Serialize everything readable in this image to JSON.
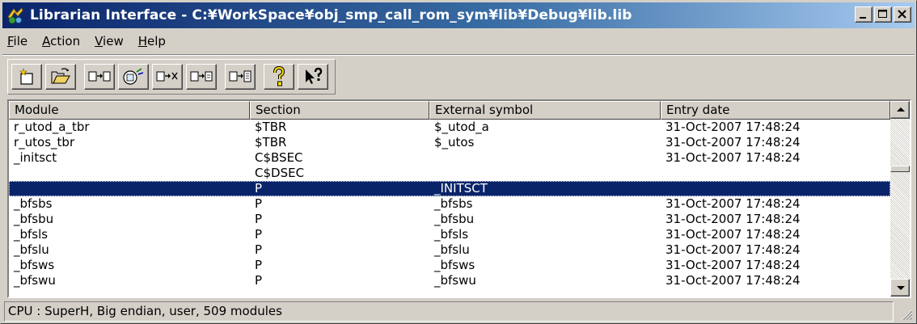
{
  "window": {
    "title": "Librarian Interface - C:¥WorkSpace¥obj_smp_call_rom_sym¥lib¥Debug¥lib.lib",
    "app_icon": "librarian-app-icon"
  },
  "menu": {
    "items": [
      {
        "label_acc": "F",
        "label_rest": "ile"
      },
      {
        "label_acc": "A",
        "label_rest": "ction"
      },
      {
        "label_acc": "V",
        "label_rest": "iew"
      },
      {
        "label_acc": "H",
        "label_rest": "elp"
      }
    ]
  },
  "toolbar": {
    "buttons": [
      "new-library-icon",
      "open-icon",
      "add-module-icon",
      "extract-module-icon",
      "delete-module-icon",
      "replace-module-icon",
      "list-icon",
      "help-icon",
      "context-help-icon"
    ]
  },
  "list": {
    "columns": [
      "Module",
      "Section",
      "External symbol",
      "Entry date"
    ],
    "rows": [
      [
        "r_utod_a_tbr",
        "$TBR",
        "$_utod_a",
        "31-Oct-2007 17:48:24"
      ],
      [
        "r_utos_tbr",
        "$TBR",
        "$_utos",
        "31-Oct-2007 17:48:24"
      ],
      [
        "_initsct",
        "C$BSEC",
        "",
        "31-Oct-2007 17:48:24"
      ],
      [
        "",
        "C$DSEC",
        "",
        ""
      ],
      [
        "",
        "P",
        "_INITSCT",
        ""
      ],
      [
        "_bfsbs",
        "P",
        "_bfsbs",
        "31-Oct-2007 17:48:24"
      ],
      [
        "_bfsbu",
        "P",
        "_bfsbu",
        "31-Oct-2007 17:48:24"
      ],
      [
        "_bfsls",
        "P",
        "_bfsls",
        "31-Oct-2007 17:48:24"
      ],
      [
        "_bfslu",
        "P",
        "_bfslu",
        "31-Oct-2007 17:48:24"
      ],
      [
        "_bfsws",
        "P",
        "_bfsws",
        "31-Oct-2007 17:48:24"
      ],
      [
        "_bfswu",
        "P",
        "_bfswu",
        "31-Oct-2007 17:48:24"
      ]
    ],
    "selected_row": 4
  },
  "status": {
    "text": "CPU : SuperH,  Big endian,  user,  509 modules"
  },
  "colors": {
    "selection": "#0a246a",
    "titlebar_start": "#0a246a",
    "titlebar_end": "#a6caf0",
    "face": "#d4d0c8"
  }
}
